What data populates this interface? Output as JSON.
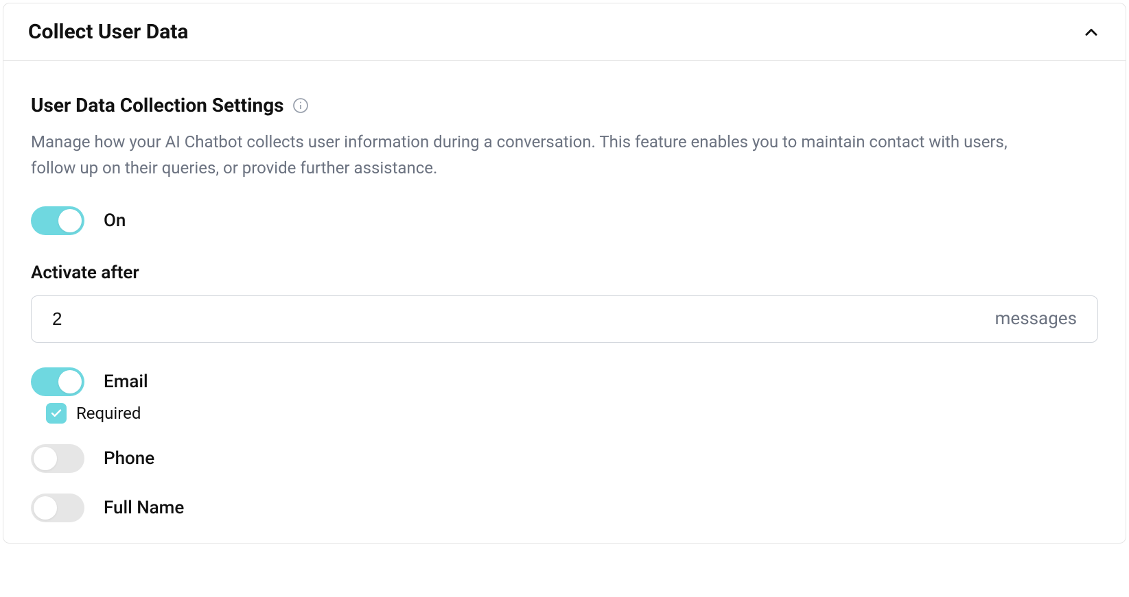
{
  "panel": {
    "title": "Collect User Data"
  },
  "section": {
    "heading": "User Data Collection Settings",
    "description": "Manage how your AI Chatbot collects user information during a conversation. This feature enables you to maintain contact with users, follow up on their queries, or provide further assistance."
  },
  "master_toggle": {
    "label": "On"
  },
  "activate_after": {
    "label": "Activate after",
    "value": "2",
    "suffix": "messages"
  },
  "fields": {
    "email": {
      "label": "Email",
      "required_label": "Required"
    },
    "phone": {
      "label": "Phone"
    },
    "fullname": {
      "label": "Full Name"
    }
  }
}
